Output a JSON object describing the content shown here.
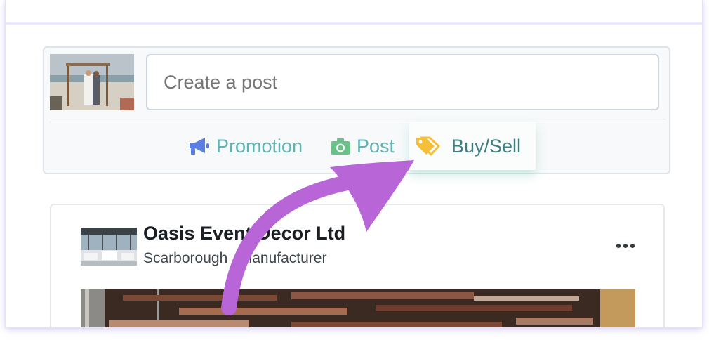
{
  "composer": {
    "placeholder": "Create a post",
    "actions": [
      {
        "label": "Promotion",
        "icon": "megaphone-icon",
        "color": "#5b7fe0"
      },
      {
        "label": "Post",
        "icon": "camera-icon",
        "color": "#6cc18a"
      },
      {
        "label": "Buy/Sell",
        "icon": "tag-icon",
        "color": "#f5bf3a"
      }
    ]
  },
  "feed": {
    "business_name": "Oasis Event Decor Ltd",
    "business_subtitle": "Scarborough , Manufacturer"
  },
  "colors": {
    "accent_teal": "#5fb3b3",
    "annotation_arrow": "#b865d8"
  }
}
